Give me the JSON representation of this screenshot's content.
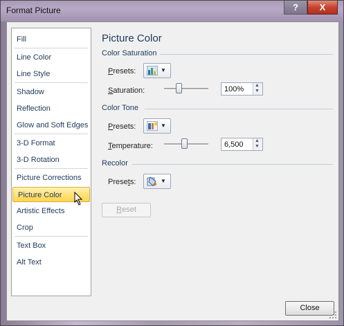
{
  "window": {
    "title": "Format Picture",
    "help_glyph": "?",
    "close_glyph": "X"
  },
  "nav": {
    "items": [
      {
        "label": "Fill"
      },
      {
        "label": "Line Color"
      },
      {
        "label": "Line Style"
      },
      {
        "label": "Shadow"
      },
      {
        "label": "Reflection"
      },
      {
        "label": "Glow and Soft Edges"
      },
      {
        "label": "3-D Format"
      },
      {
        "label": "3-D Rotation"
      },
      {
        "label": "Picture Corrections"
      },
      {
        "label": "Picture Color"
      },
      {
        "label": "Artistic Effects"
      },
      {
        "label": "Crop"
      },
      {
        "label": "Text Box"
      },
      {
        "label": "Alt Text"
      }
    ],
    "selected": "Picture Color"
  },
  "panel": {
    "heading": "Picture Color",
    "color_saturation": {
      "section": "Color Saturation",
      "presets_label": "Presets:",
      "presets_access": "P",
      "presets_rest": "resets:",
      "saturation_label": "Saturation:",
      "saturation_access": "S",
      "saturation_rest": "aturation:",
      "saturation_value": "100%",
      "saturation_level": 0.33
    },
    "color_tone": {
      "section": "Color Tone",
      "presets_access": "P",
      "presets_rest": "resets:",
      "temperature_access": "T",
      "temperature_rest": "emperature:",
      "temperature_value": "6,500",
      "temperature_level": 0.45
    },
    "recolor": {
      "section": "Recolor",
      "presets_lead": "Prese",
      "presets_access": "t",
      "presets_tail": "s:"
    },
    "reset_access": "R",
    "reset_rest": "eset"
  },
  "footer": {
    "close_label": "Close"
  },
  "colors": {
    "selected_bg": "#ffe47e",
    "title_bar": "#b8a9c7",
    "close_red": "#c7432f"
  }
}
